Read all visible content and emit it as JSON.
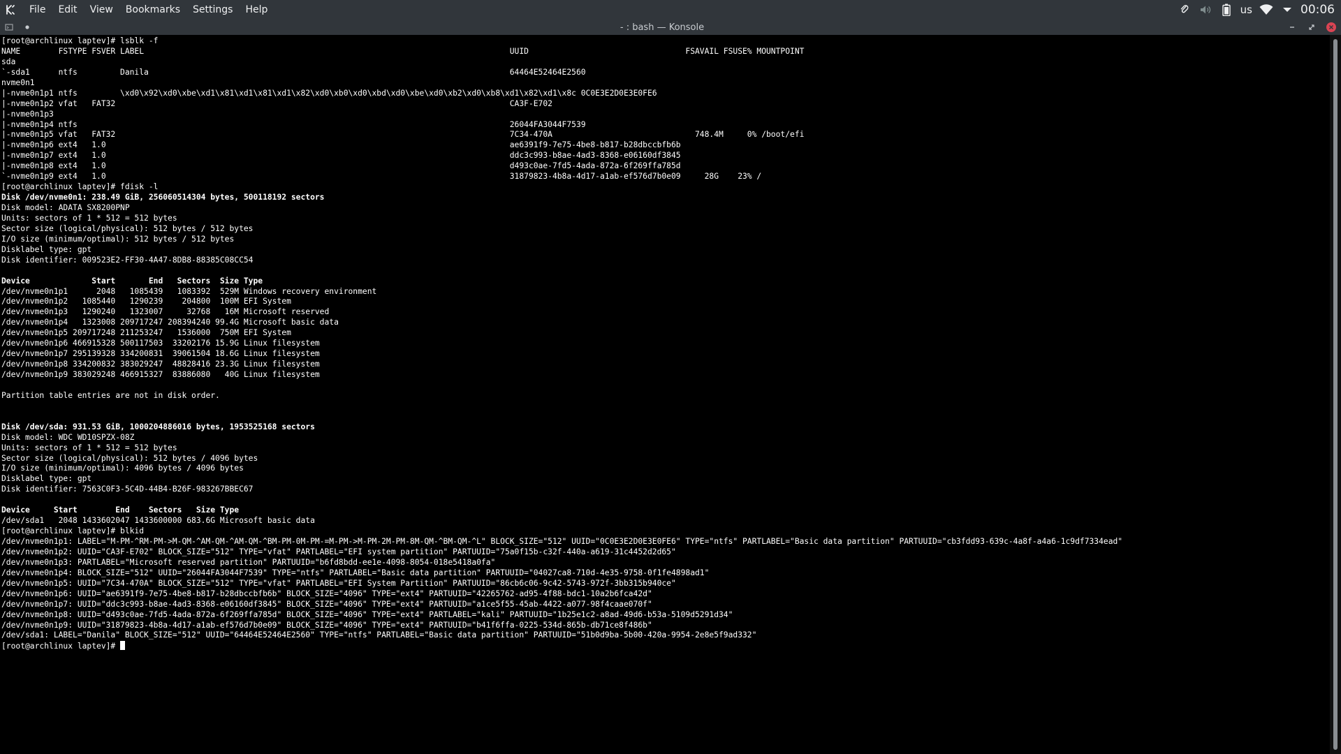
{
  "menubar": {
    "app_logo_icon": "kde-logo-icon",
    "items": [
      "File",
      "Edit",
      "View",
      "Bookmarks",
      "Settings",
      "Help"
    ],
    "tray": {
      "keyboard_layout": "us",
      "clock": "00:06",
      "icons": [
        "paperclip-icon",
        "volume-muted-icon",
        "battery-icon",
        "wifi-icon",
        "chevron-down-icon"
      ]
    }
  },
  "window": {
    "title": "- : bash — Konsole",
    "close_color": "#da4453"
  },
  "terminal": {
    "background": "#000000",
    "foreground": "#ffffff",
    "lines": [
      {
        "text": "[root@archlinux laptev]# lsblk -f",
        "bold": false
      },
      {
        "text": "NAME        FSTYPE FSVER LABEL                                                                             UUID                                 FSAVAIL FSUSE% MOUNTPOINT",
        "bold": false
      },
      {
        "text": "sda",
        "bold": false
      },
      {
        "text": "`-sda1      ntfs         Danila                                                                            64464E52464E2560",
        "bold": false
      },
      {
        "text": "nvme0n1",
        "bold": false
      },
      {
        "text": "|-nvme0n1p1 ntfs         \\xd0\\x92\\xd0\\xbe\\xd1\\x81\\xd1\\x81\\xd1\\x82\\xd0\\xb0\\xd0\\xbd\\xd0\\xbe\\xd0\\xb2\\xd0\\xb8\\xd1\\x82\\xd1\\x8c 0C0E3E2D0E3E0FE6",
        "bold": false
      },
      {
        "text": "|-nvme0n1p2 vfat   FAT32                                                                                   CA3F-E702",
        "bold": false
      },
      {
        "text": "|-nvme0n1p3",
        "bold": false
      },
      {
        "text": "|-nvme0n1p4 ntfs                                                                                           26044FA3044F7539",
        "bold": false
      },
      {
        "text": "|-nvme0n1p5 vfat   FAT32                                                                                   7C34-470A                              748.4M     0% /boot/efi",
        "bold": false
      },
      {
        "text": "|-nvme0n1p6 ext4   1.0                                                                                     ae6391f9-7e75-4be8-b817-b28dbccbfb6b",
        "bold": false
      },
      {
        "text": "|-nvme0n1p7 ext4   1.0                                                                                     ddc3c993-b8ae-4ad3-8368-e06160df3845",
        "bold": false
      },
      {
        "text": "|-nvme0n1p8 ext4   1.0                                                                                     d493c0ae-7fd5-4ada-872a-6f269ffa785d",
        "bold": false
      },
      {
        "text": "`-nvme0n1p9 ext4   1.0                                                                                     31879823-4b8a-4d17-a1ab-ef576d7b0e09     28G    23% /",
        "bold": false
      },
      {
        "text": "[root@archlinux laptev]# fdisk -l",
        "bold": false
      },
      {
        "text": "Disk /dev/nvme0n1: 238.49 GiB, 256060514304 bytes, 500118192 sectors",
        "bold": true
      },
      {
        "text": "Disk model: ADATA SX8200PNP",
        "bold": false
      },
      {
        "text": "Units: sectors of 1 * 512 = 512 bytes",
        "bold": false
      },
      {
        "text": "Sector size (logical/physical): 512 bytes / 512 bytes",
        "bold": false
      },
      {
        "text": "I/O size (minimum/optimal): 512 bytes / 512 bytes",
        "bold": false
      },
      {
        "text": "Disklabel type: gpt",
        "bold": false
      },
      {
        "text": "Disk identifier: 009523E2-FF30-4A47-8DB8-88385C08CC54",
        "bold": false
      },
      {
        "text": "",
        "bold": false
      },
      {
        "text": "Device             Start       End   Sectors  Size Type",
        "bold": true
      },
      {
        "text": "/dev/nvme0n1p1      2048   1085439   1083392  529M Windows recovery environment",
        "bold": false
      },
      {
        "text": "/dev/nvme0n1p2   1085440   1290239    204800  100M EFI System",
        "bold": false
      },
      {
        "text": "/dev/nvme0n1p3   1290240   1323007     32768   16M Microsoft reserved",
        "bold": false
      },
      {
        "text": "/dev/nvme0n1p4   1323008 209717247 208394240 99.4G Microsoft basic data",
        "bold": false
      },
      {
        "text": "/dev/nvme0n1p5 209717248 211253247   1536000  750M EFI System",
        "bold": false
      },
      {
        "text": "/dev/nvme0n1p6 466915328 500117503  33202176 15.9G Linux filesystem",
        "bold": false
      },
      {
        "text": "/dev/nvme0n1p7 295139328 334200831  39061504 18.6G Linux filesystem",
        "bold": false
      },
      {
        "text": "/dev/nvme0n1p8 334200832 383029247  48828416 23.3G Linux filesystem",
        "bold": false
      },
      {
        "text": "/dev/nvme0n1p9 383029248 466915327  83886080   40G Linux filesystem",
        "bold": false
      },
      {
        "text": "",
        "bold": false
      },
      {
        "text": "Partition table entries are not in disk order.",
        "bold": false
      },
      {
        "text": "",
        "bold": false
      },
      {
        "text": "",
        "bold": false
      },
      {
        "text": "Disk /dev/sda: 931.53 GiB, 1000204886016 bytes, 1953525168 sectors",
        "bold": true
      },
      {
        "text": "Disk model: WDC WD10SPZX-08Z",
        "bold": false
      },
      {
        "text": "Units: sectors of 1 * 512 = 512 bytes",
        "bold": false
      },
      {
        "text": "Sector size (logical/physical): 512 bytes / 4096 bytes",
        "bold": false
      },
      {
        "text": "I/O size (minimum/optimal): 4096 bytes / 4096 bytes",
        "bold": false
      },
      {
        "text": "Disklabel type: gpt",
        "bold": false
      },
      {
        "text": "Disk identifier: 7563C0F3-5C4D-44B4-B26F-983267BBEC67",
        "bold": false
      },
      {
        "text": "",
        "bold": false
      },
      {
        "text": "Device     Start        End    Sectors   Size Type",
        "bold": true
      },
      {
        "text": "/dev/sda1   2048 1433602047 1433600000 683.6G Microsoft basic data",
        "bold": false
      },
      {
        "text": "[root@archlinux laptev]# blkid",
        "bold": false
      },
      {
        "text": "/dev/nvme0n1p1: LABEL=\"M-PM-^RM-PM->M-QM-^AM-QM-^AM-QM-^BM-PM-0M-PM-=M-PM->M-PM-2M-PM-8M-QM-^BM-QM-^L\" BLOCK_SIZE=\"512\" UUID=\"0C0E3E2D0E3E0FE6\" TYPE=\"ntfs\" PARTLABEL=\"Basic data partition\" PARTUUID=\"cb3fdd93-639c-4a8f-a4a6-1c9df7334ead\"",
        "bold": false
      },
      {
        "text": "/dev/nvme0n1p2: UUID=\"CA3F-E702\" BLOCK_SIZE=\"512\" TYPE=\"vfat\" PARTLABEL=\"EFI system partition\" PARTUUID=\"75a0f15b-c32f-440a-a619-31c4452d2d65\"",
        "bold": false
      },
      {
        "text": "/dev/nvme0n1p3: PARTLABEL=\"Microsoft reserved partition\" PARTUUID=\"b6fd8bdd-ee1e-4098-8054-018e5418a0fa\"",
        "bold": false
      },
      {
        "text": "/dev/nvme0n1p4: BLOCK_SIZE=\"512\" UUID=\"26044FA3044F7539\" TYPE=\"ntfs\" PARTLABEL=\"Basic data partition\" PARTUUID=\"04027ca8-710d-4e35-9758-0f1fe4898ad1\"",
        "bold": false
      },
      {
        "text": "/dev/nvme0n1p5: UUID=\"7C34-470A\" BLOCK_SIZE=\"512\" TYPE=\"vfat\" PARTLABEL=\"EFI System Partition\" PARTUUID=\"86cb6c06-9c42-5743-972f-3bb315b940ce\"",
        "bold": false
      },
      {
        "text": "/dev/nvme0n1p6: UUID=\"ae6391f9-7e75-4be8-b817-b28dbccbfb6b\" BLOCK_SIZE=\"4096\" TYPE=\"ext4\" PARTUUID=\"42265762-ad95-4f88-bdc1-10a2b6fca42d\"",
        "bold": false
      },
      {
        "text": "/dev/nvme0n1p7: UUID=\"ddc3c993-b8ae-4ad3-8368-e06160df3845\" BLOCK_SIZE=\"4096\" TYPE=\"ext4\" PARTUUID=\"a1ce5f55-45ab-4422-a077-98f4caae070f\"",
        "bold": false
      },
      {
        "text": "/dev/nvme0n1p8: UUID=\"d493c0ae-7fd5-4ada-872a-6f269ffa785d\" BLOCK_SIZE=\"4096\" TYPE=\"ext4\" PARTLABEL=\"kali\" PARTUUID=\"1b25e1c2-a8ad-49d6-b53a-5109d5291d34\"",
        "bold": false
      },
      {
        "text": "/dev/nvme0n1p9: UUID=\"31879823-4b8a-4d17-a1ab-ef576d7b0e09\" BLOCK_SIZE=\"4096\" TYPE=\"ext4\" PARTUUID=\"b41f6ffa-0225-534d-865b-db71ce8f486b\"",
        "bold": false
      },
      {
        "text": "/dev/sda1: LABEL=\"Danila\" BLOCK_SIZE=\"512\" UUID=\"64464E52464E2560\" TYPE=\"ntfs\" PARTLABEL=\"Basic data partition\" PARTUUID=\"51b0d9ba-5b00-420a-9954-2e8e5f9ad332\"",
        "bold": false
      }
    ],
    "prompt": "[root@archlinux laptev]# "
  }
}
